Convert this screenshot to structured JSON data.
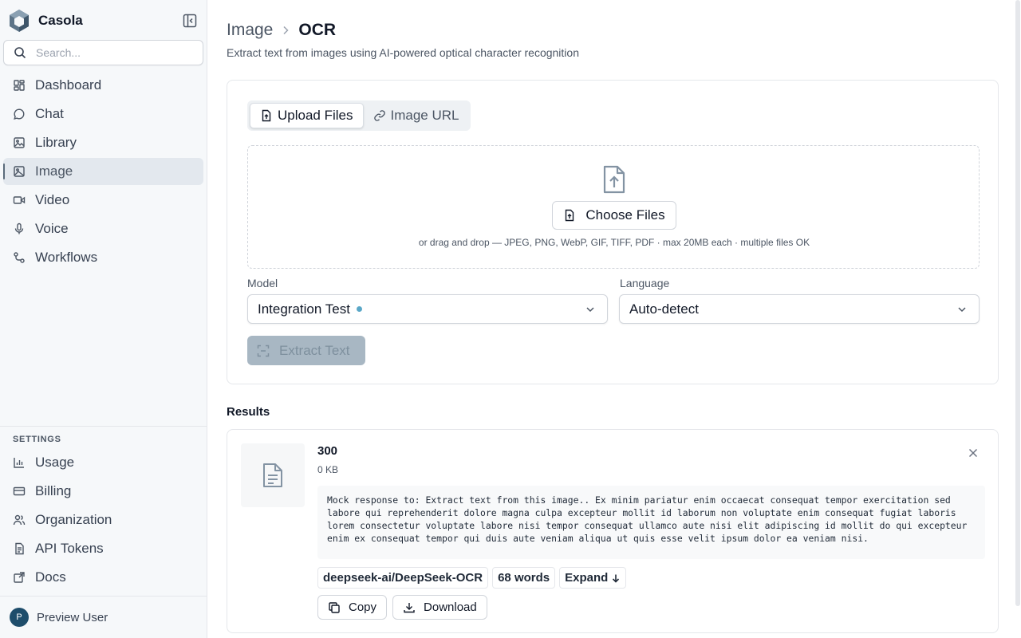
{
  "app": {
    "name": "Casola"
  },
  "search": {
    "placeholder": "Search..."
  },
  "nav": [
    {
      "label": "Dashboard",
      "icon": "dashboard-icon"
    },
    {
      "label": "Chat",
      "icon": "chat-icon"
    },
    {
      "label": "Library",
      "icon": "library-icon"
    },
    {
      "label": "Image",
      "icon": "image-icon",
      "active": true
    },
    {
      "label": "Video",
      "icon": "video-icon"
    },
    {
      "label": "Voice",
      "icon": "microphone-icon"
    },
    {
      "label": "Workflows",
      "icon": "workflow-icon"
    }
  ],
  "settings": {
    "heading": "SETTINGS",
    "items": [
      {
        "label": "Usage",
        "icon": "bar-chart-icon"
      },
      {
        "label": "Billing",
        "icon": "credit-card-icon"
      },
      {
        "label": "Organization",
        "icon": "users-icon"
      },
      {
        "label": "API Tokens",
        "icon": "token-icon"
      },
      {
        "label": "Docs",
        "icon": "external-link-icon"
      }
    ]
  },
  "user": {
    "initial": "P",
    "name": "Preview User"
  },
  "page": {
    "breadcrumb_parent": "Image",
    "breadcrumb_current": "OCR",
    "subtitle": "Extract text from images using AI-powered optical character recognition"
  },
  "tabs": [
    {
      "label": "Upload Files",
      "active": true
    },
    {
      "label": "Image URL",
      "active": false
    }
  ],
  "upload": {
    "choose_label": "Choose Files",
    "hint": "or drag and drop — JPEG, PNG, WebP, GIF, TIFF, PDF · max 20MB each · multiple files OK"
  },
  "model": {
    "label": "Model",
    "value": "Integration Test"
  },
  "language": {
    "label": "Language",
    "value": "Auto-detect"
  },
  "extract": {
    "label": "Extract Text",
    "disabled": true
  },
  "results": {
    "heading": "Results",
    "items": [
      {
        "name": "300",
        "size": "0 KB",
        "text": "Mock response to: Extract text from this image.. Ex minim pariatur enim occaecat consequat tempor exercitation sed labore qui reprehenderit dolore magna culpa excepteur mollit id laborum non voluptate enim consequat fugiat laboris lorem consectetur voluptate labore nisi tempor consequat ullamco aute nisi elit adipiscing id mollit do qui excepteur enim ex consequat tempor qui duis aute veniam aliqua ut quis esse velit ipsum dolor ea veniam nisi.",
        "model_chip": "deepseek-ai/DeepSeek-OCR",
        "words_chip": "68 words",
        "expand_label": "Expand",
        "copy_label": "Copy",
        "download_label": "Download"
      }
    ]
  },
  "colors": {
    "sidebar_bg": "#f6f8fa",
    "active_bg": "#e3e8ee",
    "status_dot": "#5aa7c7",
    "disabled_button": "#a8b7c3",
    "avatar_bg": "#1e4d6b"
  }
}
